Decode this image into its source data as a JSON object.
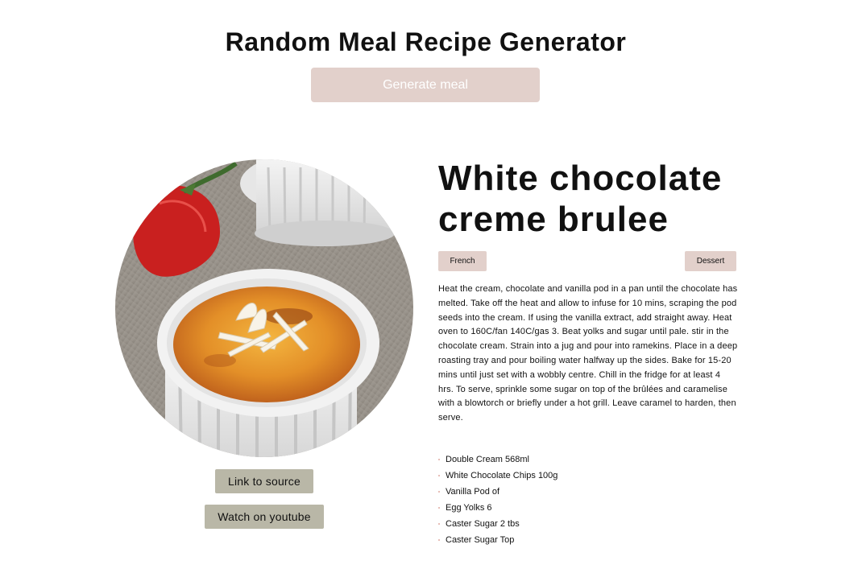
{
  "header": {
    "title": "Random Meal Recipe Generator",
    "generate_label": "Generate meal"
  },
  "meal": {
    "name": "White chocolate creme brulee",
    "area": "French",
    "category": "Dessert",
    "image_icon": "creme-brulee-photo",
    "instructions": "Heat the cream, chocolate and vanilla pod in a pan until the chocolate has melted. Take off the heat and allow to infuse for 10 mins, scraping the pod seeds into the cream. If using the vanilla extract, add straight away. Heat oven to 160C/fan 140C/gas 3. Beat yolks and sugar until pale. stir in the chocolate cream. Strain into a jug and pour into ramekins. Place in a deep roasting tray and pour boiling water halfway up the sides. Bake for 15-20 mins until just set with a wobbly centre. Chill in the fridge for at least 4 hrs. To serve, sprinkle some sugar on top of the brûlées and caramelise with a blowtorch or briefly under a hot grill. Leave caramel to harden, then serve.",
    "ingredients": [
      "Double Cream 568ml",
      "White Chocolate Chips 100g",
      "Vanilla Pod of",
      "Egg Yolks 6",
      "Caster Sugar 2 tbs",
      "Caster Sugar Top"
    ]
  },
  "links": {
    "source_label": "Link to source",
    "youtube_label": "Watch on youtube"
  },
  "colors": {
    "generate_button": "#e2d0cb",
    "tag_background": "#e2d0cb",
    "link_button": "#b9b7a7",
    "bullet": "#e0a9a0"
  }
}
